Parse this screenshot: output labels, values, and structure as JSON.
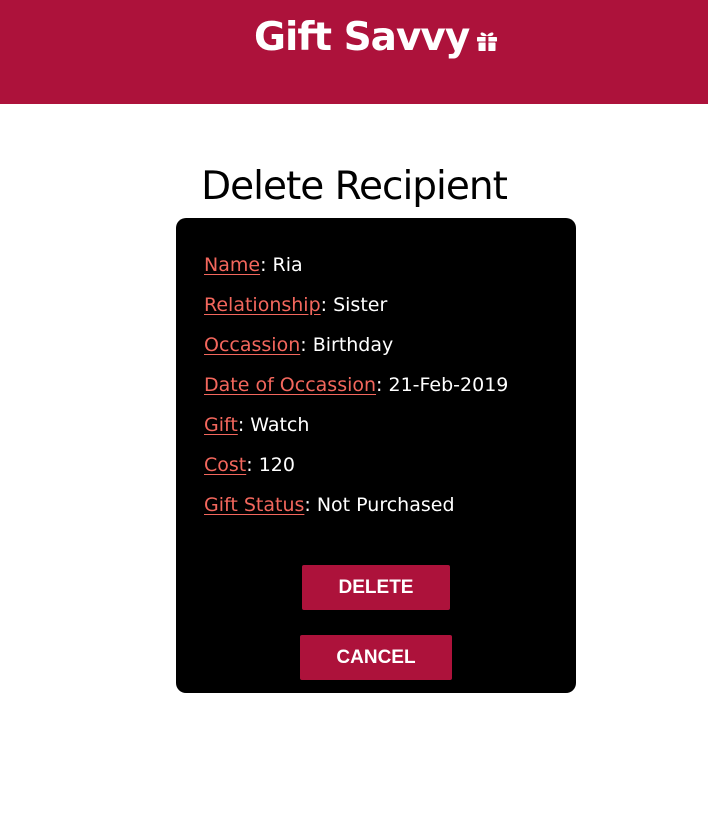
{
  "header": {
    "brand": "Gift Savvy",
    "icon": "gift-icon",
    "background_color": "#ad123b"
  },
  "page": {
    "title": "Delete Recipient"
  },
  "recipient": {
    "fields": [
      {
        "label": "Name",
        "separator": ": ",
        "value": "Ria"
      },
      {
        "label": "Relationship",
        "separator": ": ",
        "value": "Sister"
      },
      {
        "label": "Occassion",
        "separator": ": ",
        "value": "Birthday"
      },
      {
        "label": "Date of Occassion",
        "separator": ": ",
        "value": "21-Feb-2019"
      },
      {
        "label": "Gift",
        "separator": ": ",
        "value": "Watch"
      },
      {
        "label": "Cost",
        "separator": ": ",
        "value": "120"
      },
      {
        "label": "Gift Status",
        "separator": ": ",
        "value": "Not Purchased"
      }
    ],
    "label_color": "#f3675d",
    "card_color": "#000000"
  },
  "actions": {
    "delete_label": "DELETE",
    "cancel_label": "CANCEL",
    "button_color": "#ad123b"
  }
}
